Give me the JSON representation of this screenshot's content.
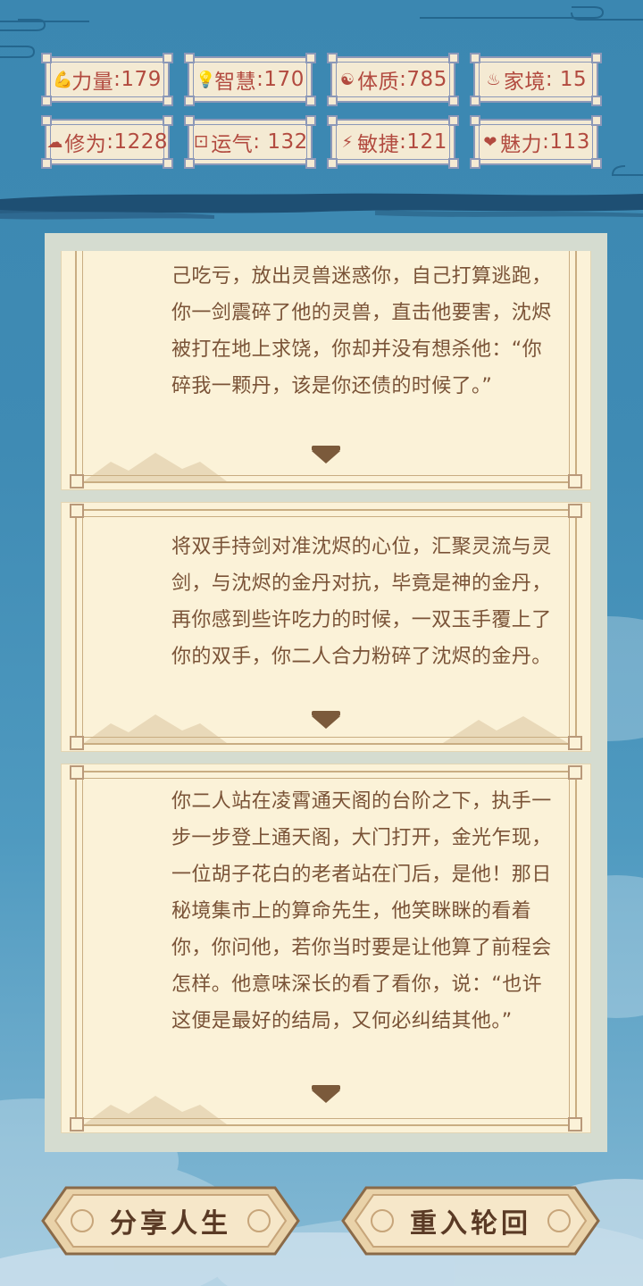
{
  "stats": [
    {
      "icon": "bicep-icon",
      "glyph": "💪",
      "label": "力量",
      "value": "179"
    },
    {
      "icon": "bulb-icon",
      "glyph": "💡",
      "label": "智慧",
      "value": "170"
    },
    {
      "icon": "yin-yang-icon",
      "glyph": "☯",
      "label": "体质",
      "value": "785"
    },
    {
      "icon": "family-icon",
      "glyph": "♨",
      "label": "家境",
      "value": " 15"
    },
    {
      "icon": "cloud-icon",
      "glyph": "☁",
      "label": "修为",
      "value": "1228"
    },
    {
      "icon": "dice-icon",
      "glyph": "⚀",
      "label": "运气",
      "value": " 132"
    },
    {
      "icon": "lightning-icon",
      "glyph": "⚡",
      "label": "敏捷",
      "value": "121"
    },
    {
      "icon": "heart-icon",
      "glyph": "❤",
      "label": "魅力",
      "value": "113"
    }
  ],
  "story": {
    "entries": [
      {
        "text": "己吃亏，放出灵兽迷惑你，自己打算逃跑，你一剑震碎了他的灵兽，直击他要害，沈烬被打在地上求饶，你却并没有想杀他：“你碎我一颗丹，该是你还债的时候了。”"
      },
      {
        "text": "将双手持剑对准沈烬的心位，汇聚灵流与灵剑，与沈烬的金丹对抗，毕竟是神的金丹，再你感到些许吃力的时候，一双玉手覆上了你的双手，你二人合力粉碎了沈烬的金丹。"
      },
      {
        "text": "你二人站在凌霄通天阁的台阶之下，执手一步一步登上通天阁，大门打开，金光乍现，一位胡子花白的老者站在门后，是他！那日秘境集市上的算命先生，他笑眯眯的看着你，你问他，若你当时要是让他算了前程会怎样。他意味深长的看了看你，说：“也许这便是最好的结局，又何必纠结其他。”"
      }
    ]
  },
  "buttons": {
    "share": "分享人生",
    "restart": "重入轮回"
  },
  "colors": {
    "stat_text": "#b24a3f",
    "story_text": "#7a5337",
    "card_bg": "#fbf2d8",
    "sky": "#3b87b1"
  }
}
